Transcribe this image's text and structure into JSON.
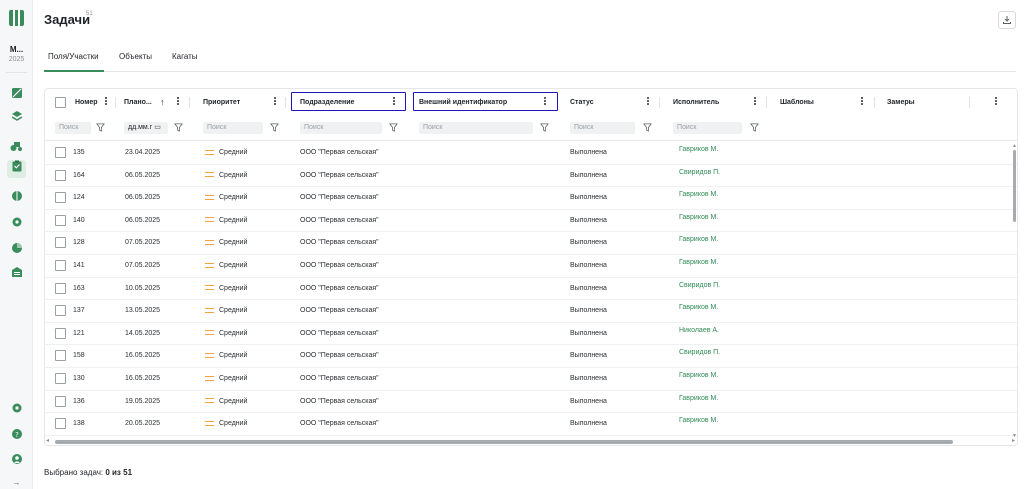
{
  "rail": {
    "org_name": "М...",
    "org_year": "2025",
    "icons": [
      "fields-icon",
      "layers-icon",
      "machinery-icon",
      "tasks-icon",
      "leaf-icon",
      "gear-icon",
      "pie-chart-icon",
      "warehouse-icon",
      "settings-icon",
      "help-icon",
      "user-icon",
      "expand-icon"
    ]
  },
  "header": {
    "title": "Задачи",
    "count": "51"
  },
  "tabs": [
    {
      "label": "Поля/Участки",
      "active": true
    },
    {
      "label": "Объекты",
      "active": false
    },
    {
      "label": "Кагаты",
      "active": false
    }
  ],
  "columns": {
    "number": "Номер",
    "planned": "Плано...",
    "priority": "Приоритет",
    "division": "Подразделение",
    "external_id": "Внешний идентификатор",
    "status": "Статус",
    "assignee": "Исполнитель",
    "templates": "Шаблоны",
    "measurements": "Замеры"
  },
  "filters": {
    "search_placeholder": "Поиск",
    "date_placeholder": "дд.мм.г"
  },
  "rows": [
    {
      "number": "135",
      "date": "23.04.2025",
      "priority": "Средний",
      "division": "ООО \"Первая сельская\"",
      "status": "Выполнена",
      "assignee": "Гавриков М."
    },
    {
      "number": "164",
      "date": "06.05.2025",
      "priority": "Средний",
      "division": "ООО \"Первая сельская\"",
      "status": "Выполнена",
      "assignee": "Свиридов П."
    },
    {
      "number": "124",
      "date": "06.05.2025",
      "priority": "Средний",
      "division": "ООО \"Первая сельская\"",
      "status": "Выполнена",
      "assignee": "Гавриков М."
    },
    {
      "number": "140",
      "date": "06.05.2025",
      "priority": "Средний",
      "division": "ООО \"Первая сельская\"",
      "status": "Выполнена",
      "assignee": "Гавриков М."
    },
    {
      "number": "128",
      "date": "07.05.2025",
      "priority": "Средний",
      "division": "ООО \"Первая сельская\"",
      "status": "Выполнена",
      "assignee": "Гавриков М."
    },
    {
      "number": "141",
      "date": "07.05.2025",
      "priority": "Средний",
      "division": "ООО \"Первая сельская\"",
      "status": "Выполнена",
      "assignee": "Гавриков М."
    },
    {
      "number": "163",
      "date": "10.05.2025",
      "priority": "Средний",
      "division": "ООО \"Первая сельская\"",
      "status": "Выполнена",
      "assignee": "Свиридов П."
    },
    {
      "number": "137",
      "date": "13.05.2025",
      "priority": "Средний",
      "division": "ООО \"Первая сельская\"",
      "status": "Выполнена",
      "assignee": "Гавриков М."
    },
    {
      "number": "121",
      "date": "14.05.2025",
      "priority": "Средний",
      "division": "ООО \"Первая сельская\"",
      "status": "Выполнена",
      "assignee": "Николаев А."
    },
    {
      "number": "158",
      "date": "16.05.2025",
      "priority": "Средний",
      "division": "ООО \"Первая сельская\"",
      "status": "Выполнена",
      "assignee": "Свиридов П."
    },
    {
      "number": "130",
      "date": "16.05.2025",
      "priority": "Средний",
      "division": "ООО \"Первая сельская\"",
      "status": "Выполнена",
      "assignee": "Гавриков М."
    },
    {
      "number": "136",
      "date": "19.05.2025",
      "priority": "Средний",
      "division": "ООО \"Первая сельская\"",
      "status": "Выполнена",
      "assignee": "Гавриков М."
    },
    {
      "number": "138",
      "date": "20.05.2025",
      "priority": "Средний",
      "division": "ООО \"Первая сельская\"",
      "status": "Выполнена",
      "assignee": "Гавриков М."
    }
  ],
  "footer": {
    "label": "Выбрано задач:",
    "value": "0 из 51"
  },
  "colors": {
    "accent": "#3a8c5c",
    "assignee_link": "#2f8a54",
    "priority_medium": "#f2a33c",
    "highlight_border": "#1a18b8"
  }
}
